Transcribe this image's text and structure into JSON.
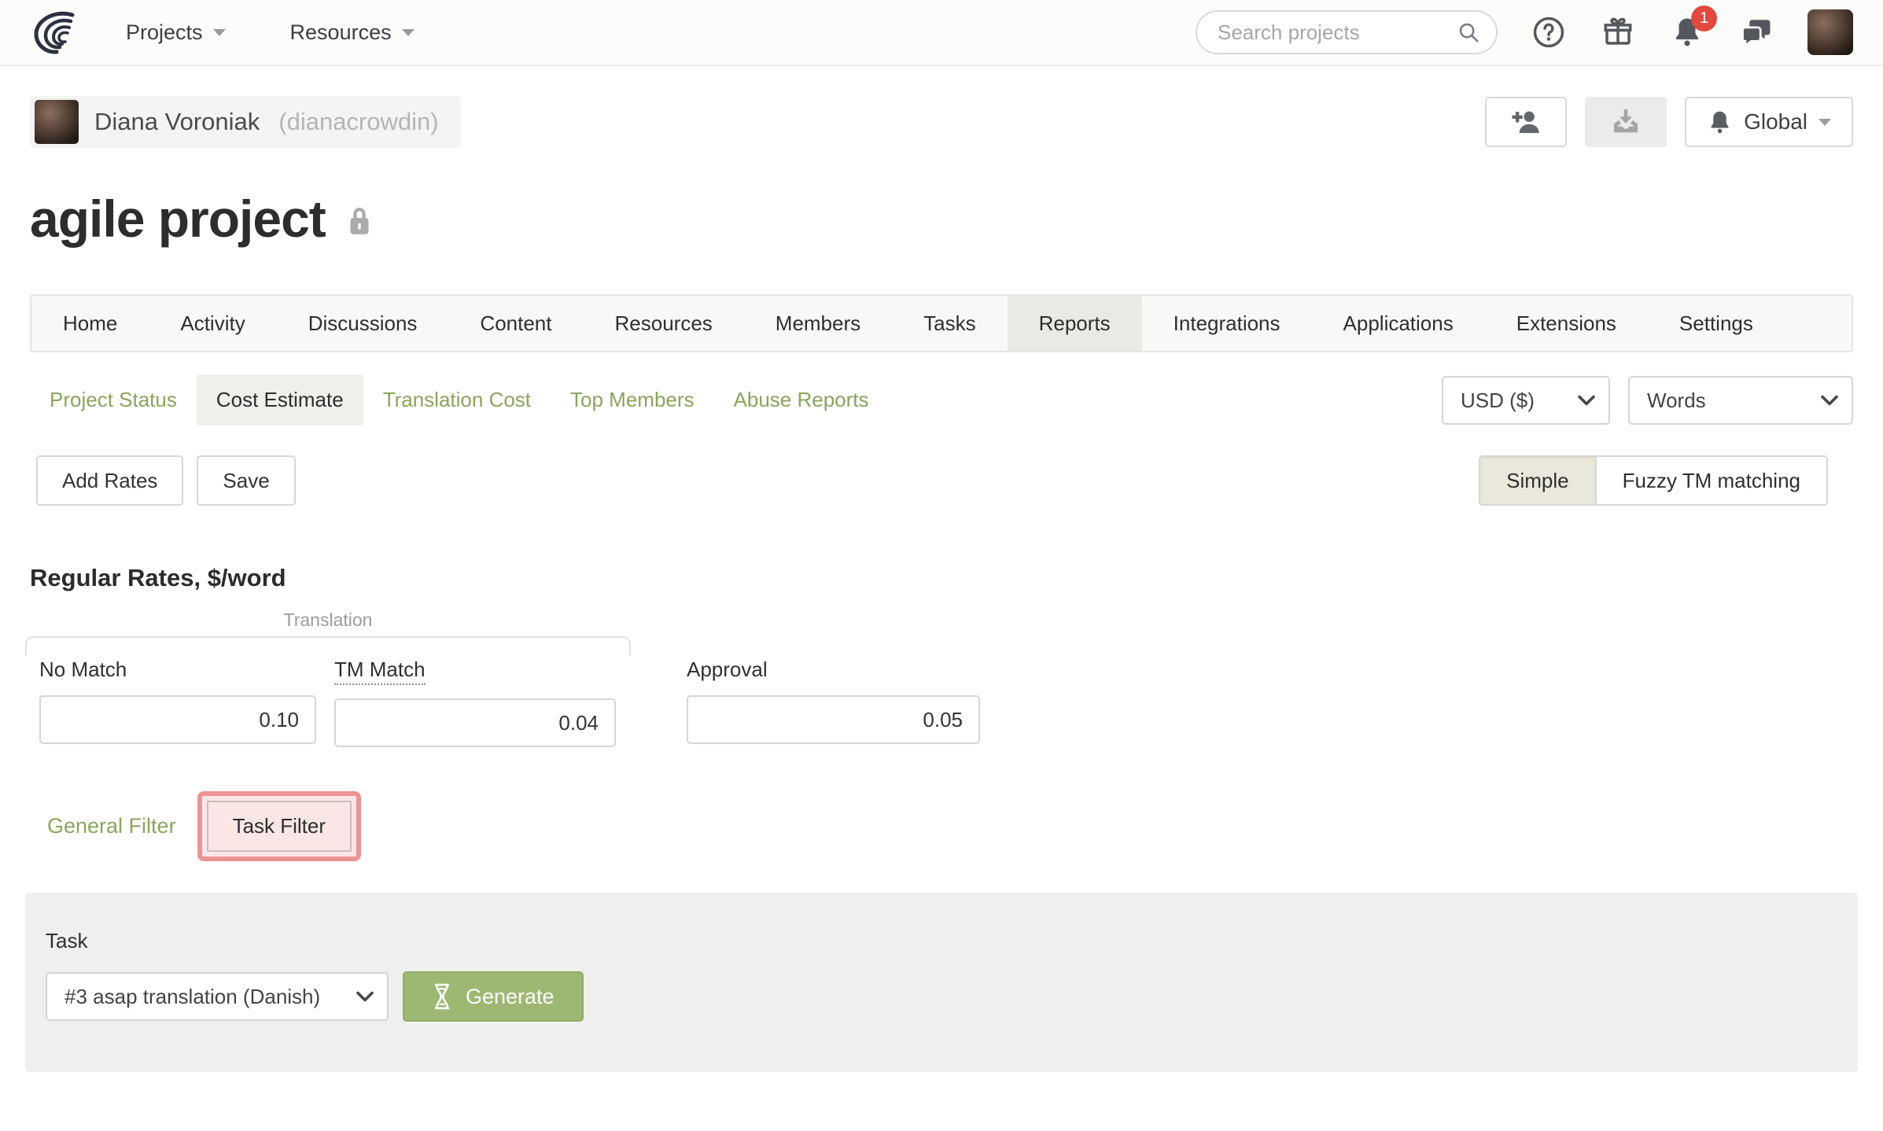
{
  "colors": {
    "accent_green": "#8aa55c",
    "generate_green": "#9db873",
    "highlight_red": "#ec9494",
    "badge_red": "#e2483d"
  },
  "icons": {
    "logo": "crowdin-logo-arcs",
    "search": "magnifier",
    "help": "question-circle",
    "gifts": "gift-box",
    "notifications": "bell",
    "messages": "chat-bubbles",
    "add_user": "person-plus",
    "download": "inbox-download",
    "global": "bell",
    "lock": "padlock",
    "generate": "hourglass",
    "caret": "chevron-down"
  },
  "topnav": {
    "menus": [
      {
        "label": "Projects"
      },
      {
        "label": "Resources"
      }
    ],
    "search": {
      "placeholder": "Search projects"
    },
    "notifications_badge": "1"
  },
  "header": {
    "user": {
      "name": "Diana Voroniak",
      "handle": "(dianacrowdin)"
    },
    "actions": {
      "global_label": "Global"
    }
  },
  "project": {
    "title": "agile project"
  },
  "tabs": {
    "items": [
      "Home",
      "Activity",
      "Discussions",
      "Content",
      "Resources",
      "Members",
      "Tasks",
      "Reports",
      "Integrations",
      "Applications",
      "Extensions",
      "Settings"
    ],
    "active": "Reports"
  },
  "report_tabs": {
    "items": [
      "Project Status",
      "Cost Estimate",
      "Translation Cost",
      "Top Members",
      "Abuse Reports"
    ],
    "active": "Cost Estimate"
  },
  "report_options": {
    "currency": "USD ($)",
    "unit": "Words"
  },
  "toolbar": {
    "add_rates": "Add Rates",
    "save": "Save",
    "mode_simple": "Simple",
    "mode_fuzzy": "Fuzzy TM matching"
  },
  "rates": {
    "heading": "Regular Rates, $/word",
    "group_label": "Translation",
    "fields": [
      {
        "label": "No Match",
        "value": "0.10"
      },
      {
        "label": "TM Match",
        "value": "0.04"
      },
      {
        "label": "Approval",
        "value": "0.05"
      }
    ]
  },
  "filters": {
    "general": "General Filter",
    "task": "Task Filter"
  },
  "task_section": {
    "label": "Task",
    "selected_task": "#3 asap translation (Danish)",
    "generate_label": "Generate"
  }
}
